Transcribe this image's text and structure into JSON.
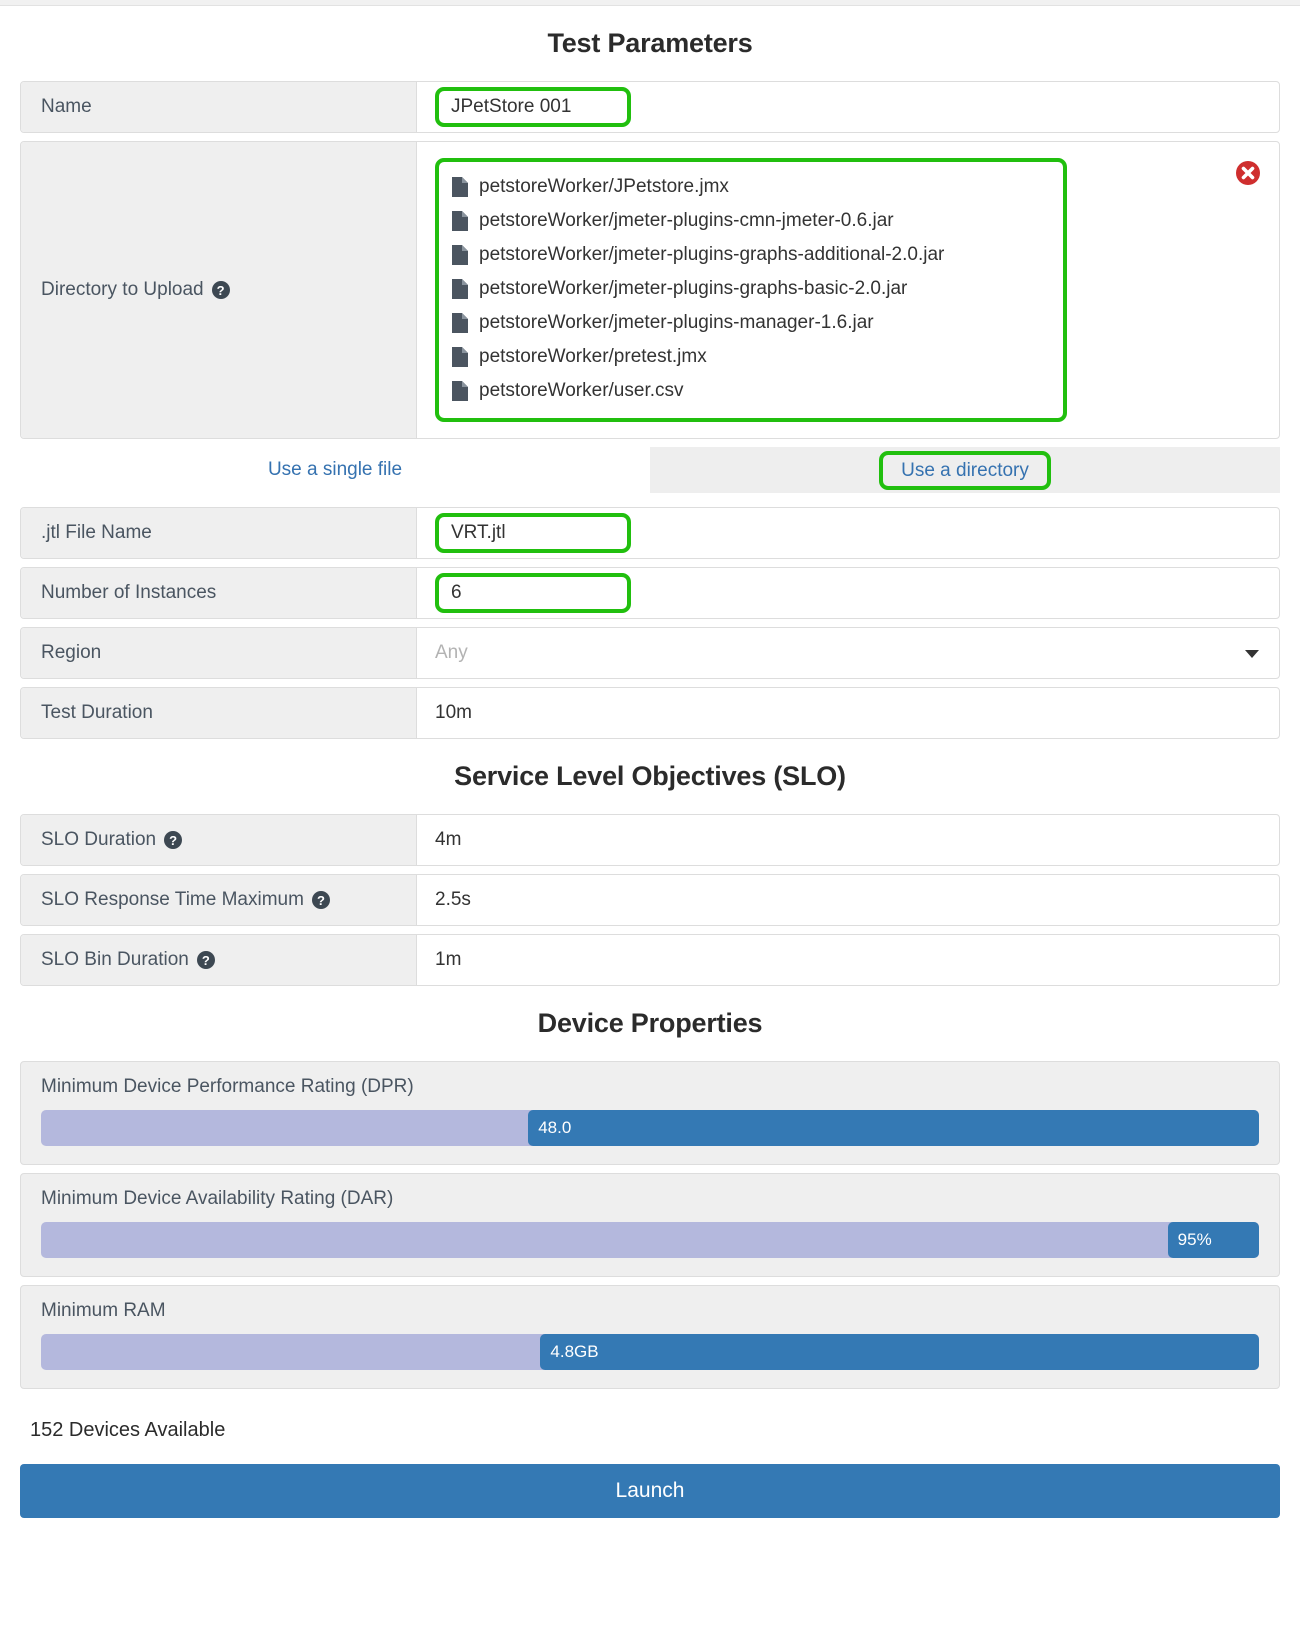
{
  "sections": {
    "test_parameters_title": "Test Parameters",
    "slo_title": "Service Level Objectives (SLO)",
    "device_title": "Device Properties"
  },
  "test_parameters": {
    "name": {
      "label": "Name",
      "value": "JPetStore 001"
    },
    "directory": {
      "label": "Directory to Upload",
      "help_icon": "question-mark-icon",
      "delete_icon": "remove-circle-icon",
      "files": [
        "petstoreWorker/JPetstore.jmx",
        "petstoreWorker/jmeter-plugins-cmn-jmeter-0.6.jar",
        "petstoreWorker/jmeter-plugins-graphs-additional-2.0.jar",
        "petstoreWorker/jmeter-plugins-graphs-basic-2.0.jar",
        "petstoreWorker/jmeter-plugins-manager-1.6.jar",
        "petstoreWorker/pretest.jmx",
        "petstoreWorker/user.csv"
      ]
    },
    "tabs": [
      {
        "label": "Use a single file",
        "active": false
      },
      {
        "label": "Use a directory",
        "active": true
      }
    ],
    "jtl_file": {
      "label": ".jtl File Name",
      "value": "VRT.jtl"
    },
    "instances": {
      "label": "Number of Instances",
      "value": "6"
    },
    "region": {
      "label": "Region",
      "value": "Any",
      "is_placeholder": true,
      "caret_icon": "chevron-down-icon"
    },
    "duration": {
      "label": "Test Duration",
      "value": "10m"
    }
  },
  "slo": {
    "rows": [
      {
        "label": "SLO Duration",
        "value": "4m",
        "help_icon": "question-mark-icon"
      },
      {
        "label": "SLO Response Time Maximum",
        "value": "2.5s",
        "help_icon": "question-mark-icon"
      },
      {
        "label": "SLO Bin Duration",
        "value": "1m",
        "help_icon": "question-mark-icon"
      }
    ]
  },
  "device_properties": {
    "sliders": [
      {
        "label": "Minimum Device Performance Rating (DPR)",
        "value": "48.0",
        "fill_percent": 40
      },
      {
        "label": "Minimum Device Availability Rating (DAR)",
        "value": "95%",
        "fill_percent": 5
      },
      {
        "label": "Minimum RAM",
        "value": "4.8GB",
        "fill_percent": 59
      }
    ]
  },
  "footer": {
    "devices_available": "152 Devices Available",
    "launch_label": "Launch"
  },
  "colors": {
    "accent_blue": "#3479b4",
    "slider_track": "#b4b8dd",
    "highlight_green": "#21bf0e",
    "delete_red": "#cf2e2e",
    "link_blue": "#3572b0"
  }
}
